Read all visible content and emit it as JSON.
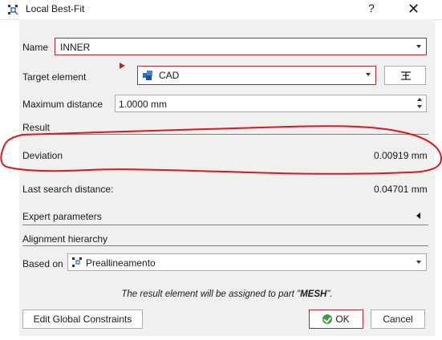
{
  "window": {
    "title": "Local Best-Fit",
    "help_label": "?",
    "close_label": "✕"
  },
  "form": {
    "name_label": "Name",
    "name_value": "INNER",
    "target_label": "Target element",
    "target_value": "CAD",
    "max_distance_label": "Maximum distance",
    "max_distance_value": "1.0000 mm"
  },
  "result": {
    "section_label": "Result",
    "deviation_label": "Deviation",
    "deviation_value": "0.00919 mm",
    "last_search_label": "Last search distance:",
    "last_search_value": "0.04701 mm"
  },
  "expert": {
    "label": "Expert parameters"
  },
  "alignment": {
    "section_label": "Alignment hierarchy",
    "based_on_label": "Based on",
    "based_on_value": "Preallineamento"
  },
  "note": {
    "prefix": "The result element will be assigned to part \"",
    "part": "MESH",
    "suffix": "\"."
  },
  "buttons": {
    "edit_constraints": "Edit Global Constraints",
    "ok": "OK",
    "cancel": "Cancel"
  },
  "annotation": {
    "color": "#e0161e"
  }
}
